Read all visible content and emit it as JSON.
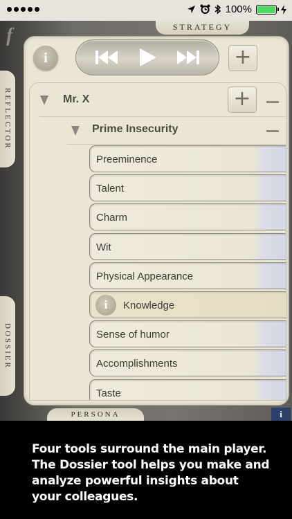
{
  "status_bar": {
    "battery_text": "100%"
  },
  "tabs": {
    "strategy": "STRATEGY",
    "reflector": "REFLECTOR",
    "dossier": "DOSSIER",
    "persona": "PERSONA"
  },
  "logo": "f",
  "info_glyph": "i",
  "small_info_glyph": "i",
  "controls": {
    "plus": "+"
  },
  "person": {
    "name": "Mr. X"
  },
  "category": {
    "name": "Prime Insecurity"
  },
  "items": [
    "Preeminence",
    "Talent",
    "Charm",
    "Wit",
    "Physical Appearance",
    "Knowledge",
    "Sense of humor",
    "Accomplishments",
    "Taste"
  ],
  "selected_item": "Knowledge",
  "caption": "Four tools surround the main player. The Dossier tool helps you make and analyze powerful insights about your colleagues.",
  "colors": {
    "panel": "#ebe6d4",
    "caption_bg": "#000000",
    "battery": "#4cd964"
  }
}
